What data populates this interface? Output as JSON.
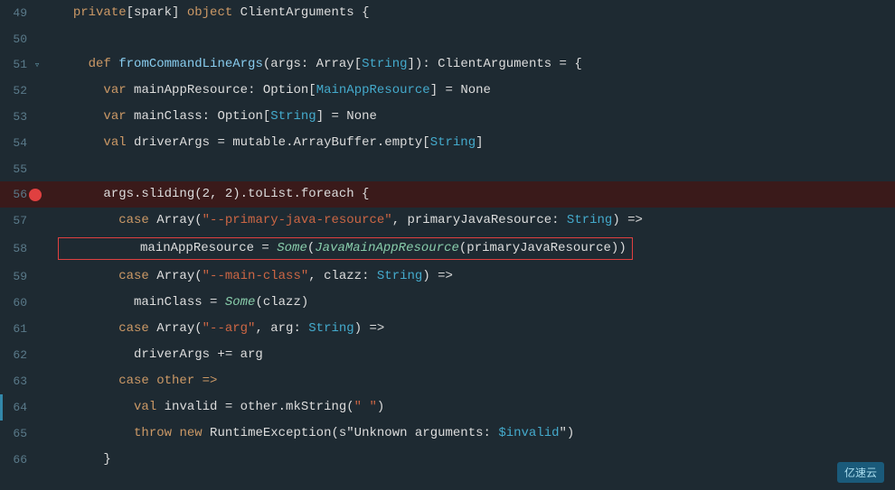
{
  "editor": {
    "background": "#1e2a32",
    "watermark": "亿速云",
    "lines": [
      {
        "number": "49",
        "hasFold": false,
        "hasBreakpoint": false,
        "hasLeftAccent": false,
        "highlighted": false,
        "tokens": [
          {
            "text": "  ",
            "cls": "normal"
          },
          {
            "text": "private",
            "cls": "kw-private"
          },
          {
            "text": "[spark] ",
            "cls": "normal"
          },
          {
            "text": "object",
            "cls": "kw-object"
          },
          {
            "text": " ClientArguments {",
            "cls": "normal"
          }
        ]
      },
      {
        "number": "50",
        "hasFold": false,
        "hasBreakpoint": false,
        "hasLeftAccent": false,
        "highlighted": false,
        "tokens": []
      },
      {
        "number": "51",
        "hasFold": true,
        "hasBreakpoint": false,
        "hasLeftAccent": false,
        "highlighted": false,
        "tokens": [
          {
            "text": "    ",
            "cls": "normal"
          },
          {
            "text": "def",
            "cls": "kw-def"
          },
          {
            "text": " ",
            "cls": "normal"
          },
          {
            "text": "fromCommandLineArgs",
            "cls": "fn-name"
          },
          {
            "text": "(args: Array[",
            "cls": "normal"
          },
          {
            "text": "String",
            "cls": "str-type"
          },
          {
            "text": "]): ClientArguments = {",
            "cls": "normal"
          }
        ]
      },
      {
        "number": "52",
        "hasFold": false,
        "hasBreakpoint": false,
        "hasLeftAccent": false,
        "highlighted": false,
        "tokens": [
          {
            "text": "      ",
            "cls": "normal"
          },
          {
            "text": "var",
            "cls": "kw-var"
          },
          {
            "text": " mainAppResource: Option[",
            "cls": "normal"
          },
          {
            "text": "MainAppResource",
            "cls": "str-type"
          },
          {
            "text": "] = None",
            "cls": "normal"
          }
        ]
      },
      {
        "number": "53",
        "hasFold": false,
        "hasBreakpoint": false,
        "hasLeftAccent": false,
        "highlighted": false,
        "tokens": [
          {
            "text": "      ",
            "cls": "normal"
          },
          {
            "text": "var",
            "cls": "kw-var"
          },
          {
            "text": " mainClass: Option[",
            "cls": "normal"
          },
          {
            "text": "String",
            "cls": "str-type"
          },
          {
            "text": "] = None",
            "cls": "normal"
          }
        ]
      },
      {
        "number": "54",
        "hasFold": false,
        "hasBreakpoint": false,
        "hasLeftAccent": false,
        "highlighted": false,
        "tokens": [
          {
            "text": "      ",
            "cls": "normal"
          },
          {
            "text": "val",
            "cls": "kw-val"
          },
          {
            "text": " driverArgs = mutable.ArrayBuffer.empty[",
            "cls": "normal"
          },
          {
            "text": "String",
            "cls": "str-type"
          },
          {
            "text": "]",
            "cls": "normal"
          }
        ]
      },
      {
        "number": "55",
        "hasFold": false,
        "hasBreakpoint": false,
        "hasLeftAccent": false,
        "highlighted": false,
        "tokens": []
      },
      {
        "number": "56",
        "hasFold": true,
        "hasBreakpoint": true,
        "hasLeftAccent": false,
        "highlighted": true,
        "tokens": [
          {
            "text": "      args.sliding(2, 2).toList.foreach {",
            "cls": "normal"
          }
        ]
      },
      {
        "number": "57",
        "hasFold": false,
        "hasBreakpoint": false,
        "hasLeftAccent": false,
        "highlighted": false,
        "tokens": [
          {
            "text": "        ",
            "cls": "normal"
          },
          {
            "text": "case",
            "cls": "kw-case"
          },
          {
            "text": " Array(",
            "cls": "normal"
          },
          {
            "text": "\"--primary-java-resource\"",
            "cls": "str-literal"
          },
          {
            "text": ", primaryJavaResource: ",
            "cls": "normal"
          },
          {
            "text": "String",
            "cls": "str-type"
          },
          {
            "text": ") =>",
            "cls": "normal"
          }
        ]
      },
      {
        "number": "58",
        "hasFold": false,
        "hasBreakpoint": false,
        "hasLeftAccent": false,
        "highlighted": false,
        "isBoxed": true,
        "tokens": [
          {
            "text": "          mainAppResource = ",
            "cls": "normal"
          },
          {
            "text": "Some",
            "cls": "italic-method"
          },
          {
            "text": "(",
            "cls": "normal"
          },
          {
            "text": "JavaMainAppResource",
            "cls": "italic-method"
          },
          {
            "text": "(primaryJavaResource))",
            "cls": "normal"
          }
        ]
      },
      {
        "number": "59",
        "hasFold": false,
        "hasBreakpoint": false,
        "hasLeftAccent": false,
        "highlighted": false,
        "tokens": [
          {
            "text": "        ",
            "cls": "normal"
          },
          {
            "text": "case",
            "cls": "kw-case"
          },
          {
            "text": " Array(",
            "cls": "normal"
          },
          {
            "text": "\"--main-class\"",
            "cls": "str-literal"
          },
          {
            "text": ", clazz: ",
            "cls": "normal"
          },
          {
            "text": "String",
            "cls": "str-type"
          },
          {
            "text": ") =>",
            "cls": "normal"
          }
        ]
      },
      {
        "number": "60",
        "hasFold": false,
        "hasBreakpoint": false,
        "hasLeftAccent": false,
        "highlighted": false,
        "tokens": [
          {
            "text": "          mainClass = ",
            "cls": "normal"
          },
          {
            "text": "Some",
            "cls": "italic-method"
          },
          {
            "text": "(clazz)",
            "cls": "normal"
          }
        ]
      },
      {
        "number": "61",
        "hasFold": false,
        "hasBreakpoint": false,
        "hasLeftAccent": false,
        "highlighted": false,
        "tokens": [
          {
            "text": "        ",
            "cls": "normal"
          },
          {
            "text": "case",
            "cls": "kw-case"
          },
          {
            "text": " Array(",
            "cls": "normal"
          },
          {
            "text": "\"--arg\"",
            "cls": "str-literal"
          },
          {
            "text": ", arg: ",
            "cls": "normal"
          },
          {
            "text": "String",
            "cls": "str-type"
          },
          {
            "text": ") =>",
            "cls": "normal"
          }
        ]
      },
      {
        "number": "62",
        "hasFold": false,
        "hasBreakpoint": false,
        "hasLeftAccent": false,
        "highlighted": false,
        "tokens": [
          {
            "text": "          driverArgs += arg",
            "cls": "normal"
          }
        ]
      },
      {
        "number": "63",
        "hasFold": false,
        "hasBreakpoint": false,
        "hasLeftAccent": false,
        "highlighted": false,
        "tokens": [
          {
            "text": "        ",
            "cls": "normal"
          },
          {
            "text": "case other =>",
            "cls": "kw-case"
          }
        ]
      },
      {
        "number": "64",
        "hasFold": false,
        "hasBreakpoint": false,
        "hasLeftAccent": true,
        "highlighted": false,
        "tokens": [
          {
            "text": "          ",
            "cls": "normal"
          },
          {
            "text": "val",
            "cls": "kw-val"
          },
          {
            "text": " invalid = other.mkString(",
            "cls": "normal"
          },
          {
            "text": "\" \"",
            "cls": "str-literal"
          },
          {
            "text": ")",
            "cls": "normal"
          }
        ]
      },
      {
        "number": "65",
        "hasFold": false,
        "hasBreakpoint": false,
        "hasLeftAccent": false,
        "highlighted": false,
        "tokens": [
          {
            "text": "          ",
            "cls": "normal"
          },
          {
            "text": "throw",
            "cls": "kw-throw"
          },
          {
            "text": " ",
            "cls": "normal"
          },
          {
            "text": "new",
            "cls": "kw-new"
          },
          {
            "text": " RuntimeException(s\"Unknown arguments: ",
            "cls": "normal"
          },
          {
            "text": "$invalid",
            "cls": "str-type"
          },
          {
            "text": "\")",
            "cls": "normal"
          }
        ]
      },
      {
        "number": "66",
        "hasFold": false,
        "hasBreakpoint": false,
        "hasLeftAccent": false,
        "highlighted": false,
        "tokens": [
          {
            "text": "      }",
            "cls": "normal"
          }
        ]
      }
    ]
  }
}
